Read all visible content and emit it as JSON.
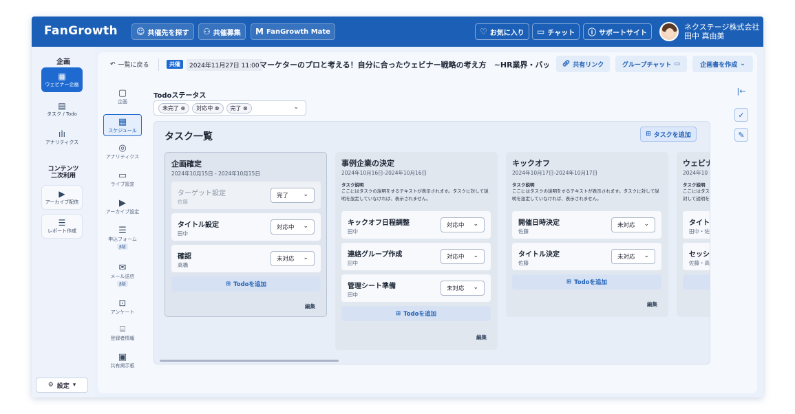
{
  "topbar": {
    "logo": "FanGrowth",
    "buttons": [
      {
        "icon": "face-search-icon",
        "label": "共催先を探す"
      },
      {
        "icon": "people-icon",
        "label": "共催募集"
      },
      {
        "icon": "fangrowth-mate-icon",
        "label": "FanGrowth Mate"
      }
    ],
    "links": [
      {
        "icon": "heart-icon",
        "label": "お気に入り"
      },
      {
        "icon": "chat-icon",
        "label": "チャット"
      },
      {
        "icon": "help-icon",
        "label": "サポートサイト"
      }
    ],
    "user": {
      "company": "ネクステージ株式会社",
      "name": "田中 真由美"
    }
  },
  "leftnav": {
    "heading_plan": "企画",
    "items": [
      {
        "icon": "webinar-icon",
        "label": "ウェビナー企画",
        "active": true
      },
      {
        "icon": "task-icon",
        "label": "タスク / Todo",
        "active": false
      },
      {
        "icon": "analytics-icon",
        "label": "アナリティクス",
        "active": false
      }
    ],
    "heading_content": "コンテンツ\n二次利用",
    "content_items": [
      {
        "icon": "archive-icon",
        "label": "アーカイブ配信"
      },
      {
        "icon": "report-icon",
        "label": "レポート作成"
      }
    ],
    "settings": "設定"
  },
  "header": {
    "back": "一覧に戻る",
    "kyosai_badge": "共催",
    "datetime": "2024年11月27日 11:00",
    "title": "マーケターのプロと考える！自分に合ったウェビナー戦略の考え方　~HR業界・バック…",
    "share_link": "共有リンク",
    "group_chat": "グループチャット",
    "create_plan": "企画書を作成"
  },
  "subnav": [
    {
      "icon": "plan-icon",
      "label": "企画",
      "beta": false
    },
    {
      "icon": "schedule-icon",
      "label": "スケジュール",
      "beta": false,
      "active": true
    },
    {
      "icon": "analytics-icon",
      "label": "アナリティクス",
      "beta": false
    },
    {
      "icon": "live-icon",
      "label": "ライブ設定",
      "beta": false
    },
    {
      "icon": "archive-icon",
      "label": "アーカイブ設定",
      "beta": false
    },
    {
      "icon": "form-icon",
      "label": "申込フォーム",
      "beta": true
    },
    {
      "icon": "mail-icon",
      "label": "メール送信",
      "beta": true
    },
    {
      "icon": "survey-icon",
      "label": "アンケート",
      "beta": false
    },
    {
      "icon": "registrant-icon",
      "label": "登録者情報",
      "beta": false
    },
    {
      "icon": "board-icon",
      "label": "共有掲示板",
      "beta": false
    }
  ],
  "beta_label": "β版",
  "todo_status": {
    "label": "Todoステータス",
    "tags": [
      "未完了",
      "対応中",
      "完了"
    ]
  },
  "board": {
    "title": "タスク一覧",
    "add_task": "タスクを追加",
    "add_todo": "Todoを追加",
    "edit": "編集",
    "desc_label": "タスク説明",
    "columns": [
      {
        "title": "企画確定",
        "date": "2024年10月15日 - 2024年10月15日",
        "desc": "",
        "todos": [
          {
            "title": "ターゲット設定",
            "assignee": "佐藤",
            "status": "完了",
            "done": true
          },
          {
            "title": "タイトル設定",
            "assignee": "田中",
            "status": "対応中",
            "done": false
          },
          {
            "title": "確認",
            "assignee": "高橋",
            "status": "未対応",
            "done": false
          }
        ]
      },
      {
        "title": "事例企業の決定",
        "date": "2024年10月16日-2024年10月16日",
        "desc": "ここにはタスクの説明をするテキストが表示されます。タスクに対して説明を設定していなければ、表示されません。",
        "todos": [
          {
            "title": "キックオフ日程調整",
            "assignee": "田中",
            "status": "対応中",
            "done": false
          },
          {
            "title": "連絡グループ作成",
            "assignee": "田中",
            "status": "対応中",
            "done": false
          },
          {
            "title": "管理シート準備",
            "assignee": "田中",
            "status": "未対応",
            "done": false
          }
        ]
      },
      {
        "title": "キックオフ",
        "date": "2024年10月17日-2024年10月17日",
        "desc": "ここにはタスクの説明をするテキストが表示されます。タスクに対して説明を設定していなければ、表示されません。",
        "todos": [
          {
            "title": "開催日時決定",
            "assignee": "佐藤",
            "status": "未対応",
            "done": false
          },
          {
            "title": "タイトル決定",
            "assignee": "佐藤",
            "status": "未対応",
            "done": false
          }
        ]
      },
      {
        "title": "ウェビナ",
        "date": "2024年10",
        "desc": "ここにはタス対して説明を",
        "todos": [
          {
            "title": "タイト",
            "assignee": "田中・佐",
            "status": "",
            "done": false
          },
          {
            "title": "セッシ",
            "assignee": "佐藤・高",
            "status": "",
            "done": false
          }
        ]
      }
    ]
  }
}
